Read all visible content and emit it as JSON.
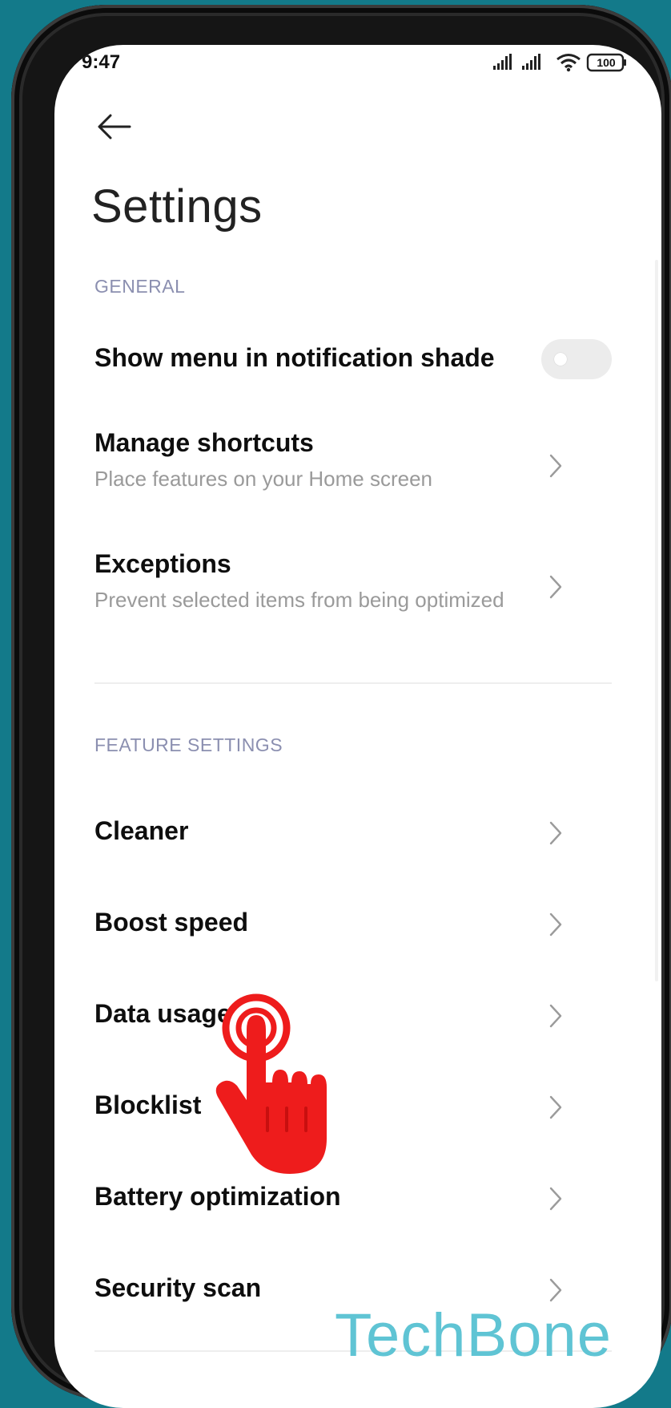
{
  "status_bar": {
    "time": "9:47",
    "battery": "100",
    "icons": [
      "signal-icon",
      "signal-icon",
      "wifi-icon",
      "battery-icon"
    ]
  },
  "header": {
    "back_icon": "back-arrow-icon",
    "title": "Settings"
  },
  "general": {
    "header": "GENERAL",
    "toggle_item": {
      "label": "Show menu in notification shade",
      "enabled": false
    },
    "items": [
      {
        "label": "Manage shortcuts",
        "subtitle": "Place features on your Home screen"
      },
      {
        "label": "Exceptions",
        "subtitle": "Prevent selected items from being optimized"
      }
    ]
  },
  "feature_settings": {
    "header": "FEATURE SETTINGS",
    "items": [
      {
        "label": "Cleaner"
      },
      {
        "label": "Boost speed"
      },
      {
        "label": "Data usage"
      },
      {
        "label": "Blocklist"
      },
      {
        "label": "Battery optimization"
      },
      {
        "label": "Security scan"
      }
    ]
  },
  "overlay": {
    "tap_indicator_icon": "tap-hand-icon",
    "watermark": "TechBone"
  },
  "colors": {
    "background": "#137a8a",
    "section_header": "#8b8fb0",
    "tap_hand": "#ee1c1c",
    "watermark": "#5fc4d4"
  }
}
